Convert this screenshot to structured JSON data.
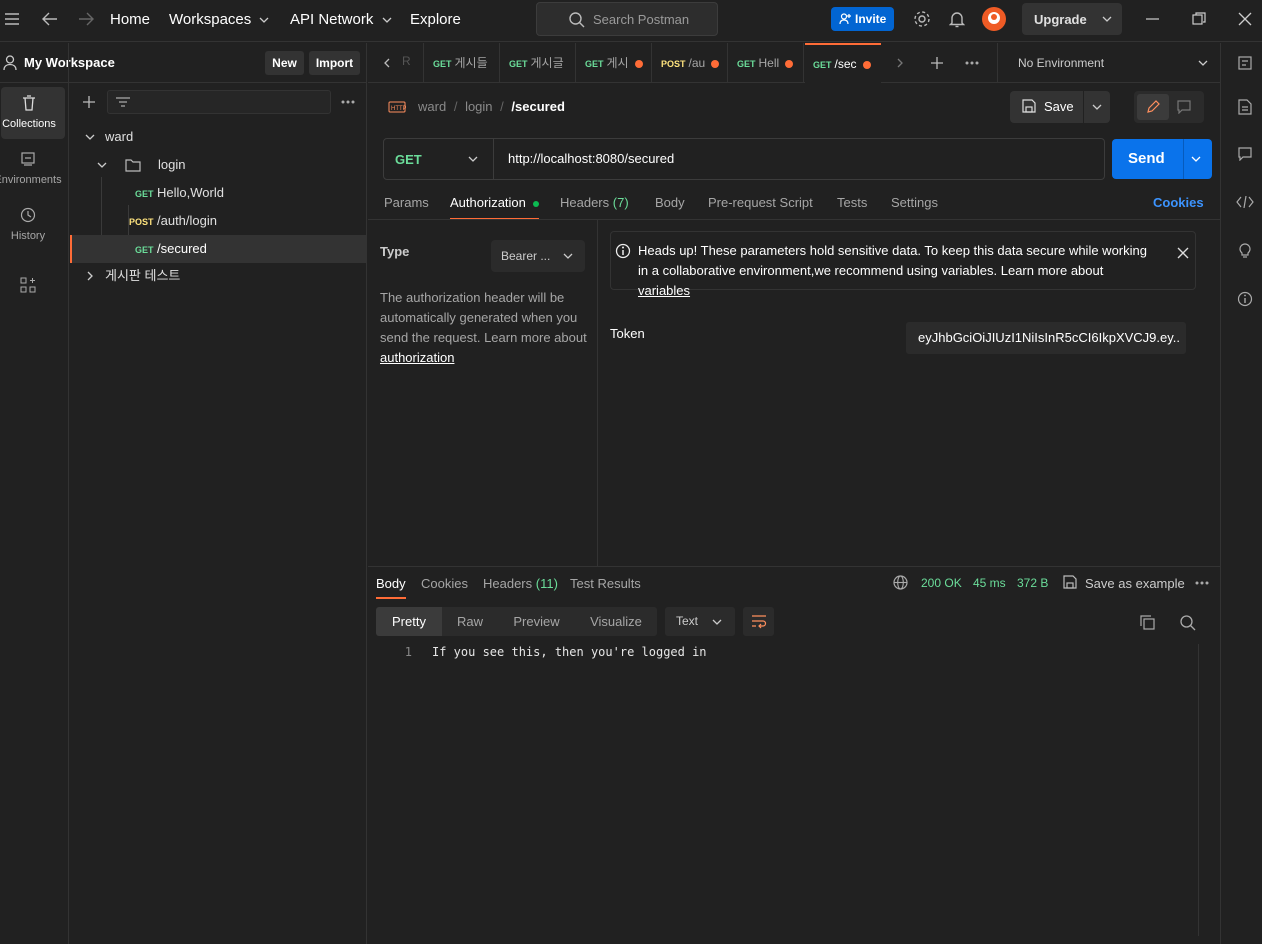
{
  "topbar": {
    "home": "Home",
    "workspaces": "Workspaces",
    "api_network": "API Network",
    "explore": "Explore",
    "search_placeholder": "Search Postman",
    "invite": "Invite",
    "upgrade": "Upgrade"
  },
  "rail": {
    "collections": "Collections",
    "environments": "Environments",
    "history": "History"
  },
  "sidebar": {
    "workspace_name": "My Workspace",
    "new_label": "New",
    "import_label": "Import",
    "tree": {
      "collection": "ward",
      "folder": "login",
      "requests": [
        {
          "method": "GET",
          "name": "Hello,World"
        },
        {
          "method": "POST",
          "name": "/auth/login"
        },
        {
          "method": "GET",
          "name": "/secured"
        }
      ],
      "collection2": "게시판 테스트"
    }
  },
  "tabs": {
    "items": [
      {
        "method": "GET",
        "name": "게시들"
      },
      {
        "method": "GET",
        "name": "게시글"
      },
      {
        "method": "GET",
        "name": "게시"
      },
      {
        "method": "POST",
        "name": "/au"
      },
      {
        "method": "GET",
        "name": "Hell"
      },
      {
        "method": "GET",
        "name": "/sec"
      }
    ],
    "environment": "No Environment"
  },
  "request": {
    "breadcrumb": {
      "a": "ward",
      "b": "login",
      "c": "/secured"
    },
    "save_label": "Save",
    "method": "GET",
    "url": "http://localhost:8080/secured",
    "send_label": "Send",
    "tabs": {
      "params": "Params",
      "authorization": "Authorization",
      "headers": "Headers",
      "headers_count": "(7)",
      "body": "Body",
      "prerequest": "Pre-request Script",
      "tests": "Tests",
      "settings": "Settings",
      "cookies": "Cookies"
    },
    "auth": {
      "type_label": "Type",
      "type_value": "Bearer ...",
      "desc": "The authorization header will be automatically generated when you send the request. Learn more about",
      "desc_link": "authorization",
      "alert": "Heads up! These parameters hold sensitive data. To keep this data secure while working in a collaborative environment,we recommend using variables. Learn more about",
      "alert_link": "variables",
      "token_label": "Token",
      "token_value": "eyJhbGciOiJIUzI1NiIsInR5cCI6IkpXVCJ9.ey..."
    }
  },
  "response": {
    "tabs": {
      "body": "Body",
      "cookies": "Cookies",
      "headers": "Headers",
      "headers_count": "(11)",
      "test_results": "Test Results"
    },
    "status": "200 OK",
    "time": "45 ms",
    "size": "372 B",
    "save_example": "Save as example",
    "views": {
      "pretty": "Pretty",
      "raw": "Raw",
      "preview": "Preview",
      "visualize": "Visualize",
      "format": "Text"
    },
    "line_number": "1",
    "body_text": "If you see this, then you're logged in"
  },
  "colors": {
    "accent_blue": "#0a73eb",
    "orange": "#ff6c37",
    "get_green": "#6bdd9a",
    "post_yellow": "#ffe47e"
  }
}
